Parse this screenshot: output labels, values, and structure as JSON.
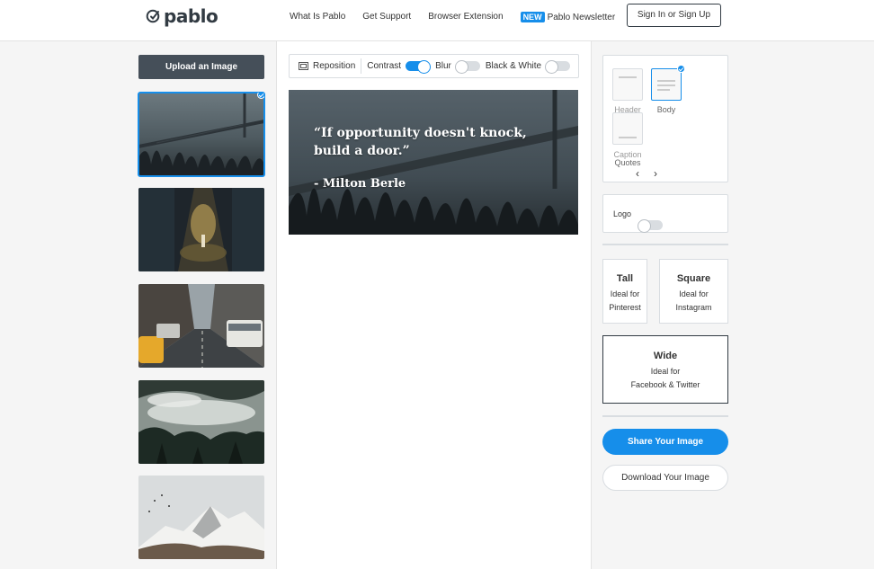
{
  "brand": {
    "name": "pablo"
  },
  "nav": {
    "items": [
      "What Is Pablo",
      "Get Support",
      "Browser Extension"
    ],
    "newsletter_badge": "NEW",
    "newsletter_label": "Pablo Newsletter",
    "signin_label": "Sign In or Sign Up"
  },
  "gallery": {
    "upload_label": "Upload an Image",
    "thumbnails": [
      {
        "name": "bridge-grass",
        "selected": true
      },
      {
        "name": "lit-alley"
      },
      {
        "name": "city-street-taxis"
      },
      {
        "name": "foggy-valley"
      },
      {
        "name": "snowy-mountain"
      }
    ]
  },
  "toolbar": {
    "reposition_label": "Reposition",
    "contrast_label": "Contrast",
    "contrast_on": true,
    "blur_label": "Blur",
    "blur_on": false,
    "bw_label": "Black & White",
    "bw_on": false
  },
  "canvas": {
    "quote": "“If opportunity doesn't knock, build a door.”",
    "author": "- Milton Berle"
  },
  "text_styles": {
    "header_label": "Header",
    "body_label": "Body",
    "caption_label": "Caption",
    "quotes_label": "Quotes",
    "selected": "body",
    "prev_icon": "‹",
    "next_icon": "›"
  },
  "logo_option": {
    "label": "Logo",
    "enabled": false
  },
  "sizes": {
    "tall": {
      "title": "Tall",
      "desc1": "Ideal for",
      "desc2": "Pinterest"
    },
    "square": {
      "title": "Square",
      "desc1": "Ideal for",
      "desc2": "Instagram"
    },
    "wide": {
      "title": "Wide",
      "desc1": "Ideal for",
      "desc2": "Facebook & Twitter",
      "selected": true
    }
  },
  "actions": {
    "share_label": "Share Your Image",
    "download_label": "Download Your Image"
  },
  "colors": {
    "accent": "#168eea",
    "dark": "#323b43",
    "upload_button": "#454f59"
  }
}
